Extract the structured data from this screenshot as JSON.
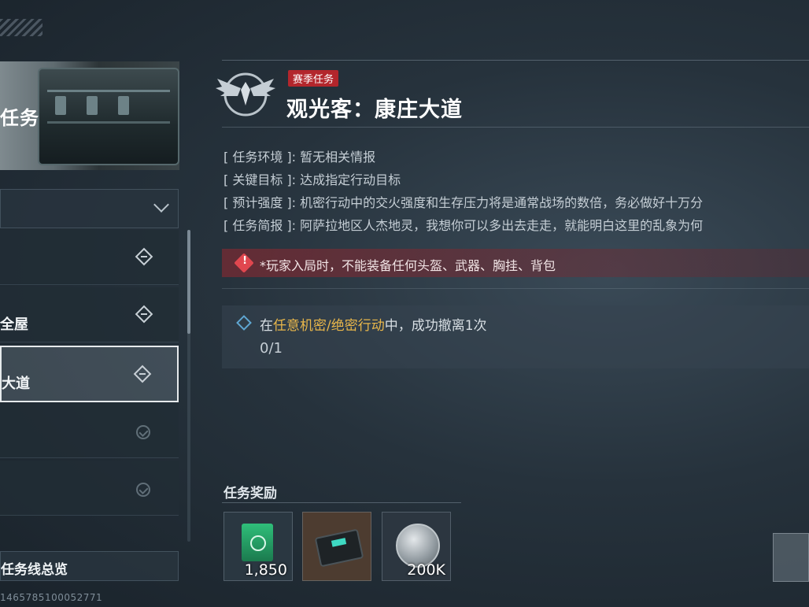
{
  "left_panel": {
    "banner_title": "任务",
    "items": [
      {
        "label": "",
        "state": "active"
      },
      {
        "label": "全屋",
        "state": "active"
      },
      {
        "label": "大道",
        "state": "selected"
      },
      {
        "label": "",
        "state": "done"
      },
      {
        "label": "",
        "state": "done"
      }
    ],
    "overview_label": "任务线总览",
    "uid": "1465785100052771"
  },
  "quest": {
    "tag": "赛季任务",
    "title": "观光客：康庄大道",
    "info": [
      {
        "key": "[ 任务环境 ]:",
        "value": "暂无相关情报"
      },
      {
        "key": "[ 关键目标 ]:",
        "value": "达成指定行动目标"
      },
      {
        "key": "[ 预计强度 ]:",
        "value": "机密行动中的交火强度和生存压力将是通常战场的数倍，务必做好十万分"
      },
      {
        "key": "[ 任务简报 ]:",
        "value": "阿萨拉地区人杰地灵，我想你可以多出去走走，就能明白这里的乱象为何"
      }
    ],
    "warning": "*玩家入局时，不能装备任何头盔、武器、胸挂、背包",
    "objective": {
      "prefix": "在",
      "highlight": "任意机密/绝密行动",
      "suffix": "中，成功撤离1次",
      "progress": "0/1"
    }
  },
  "rewards": {
    "heading": "任务奖励",
    "items": [
      {
        "icon": "cash-icon",
        "amount": "1,850"
      },
      {
        "icon": "gear-case-icon",
        "amount": ""
      },
      {
        "icon": "coin-icon",
        "amount": "200K"
      }
    ]
  },
  "colors": {
    "accent_tag": "#b3262c",
    "highlight": "#e8b64a",
    "warning_bg": "#8c2830"
  }
}
